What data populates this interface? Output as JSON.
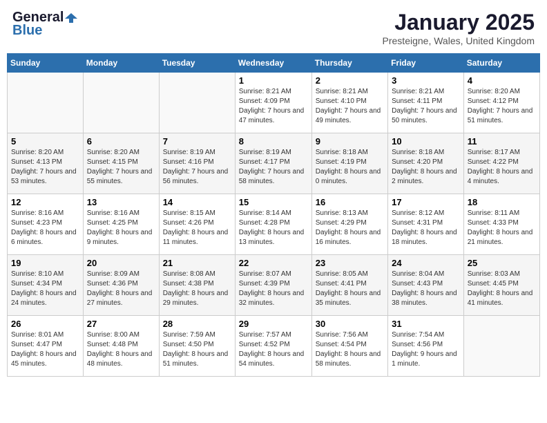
{
  "logo": {
    "general": "General",
    "blue": "Blue"
  },
  "header": {
    "title": "January 2025",
    "subtitle": "Presteigne, Wales, United Kingdom"
  },
  "weekdays": [
    "Sunday",
    "Monday",
    "Tuesday",
    "Wednesday",
    "Thursday",
    "Friday",
    "Saturday"
  ],
  "weeks": [
    [
      {
        "day": "",
        "info": ""
      },
      {
        "day": "",
        "info": ""
      },
      {
        "day": "",
        "info": ""
      },
      {
        "day": "1",
        "info": "Sunrise: 8:21 AM\nSunset: 4:09 PM\nDaylight: 7 hours and 47 minutes."
      },
      {
        "day": "2",
        "info": "Sunrise: 8:21 AM\nSunset: 4:10 PM\nDaylight: 7 hours and 49 minutes."
      },
      {
        "day": "3",
        "info": "Sunrise: 8:21 AM\nSunset: 4:11 PM\nDaylight: 7 hours and 50 minutes."
      },
      {
        "day": "4",
        "info": "Sunrise: 8:20 AM\nSunset: 4:12 PM\nDaylight: 7 hours and 51 minutes."
      }
    ],
    [
      {
        "day": "5",
        "info": "Sunrise: 8:20 AM\nSunset: 4:13 PM\nDaylight: 7 hours and 53 minutes."
      },
      {
        "day": "6",
        "info": "Sunrise: 8:20 AM\nSunset: 4:15 PM\nDaylight: 7 hours and 55 minutes."
      },
      {
        "day": "7",
        "info": "Sunrise: 8:19 AM\nSunset: 4:16 PM\nDaylight: 7 hours and 56 minutes."
      },
      {
        "day": "8",
        "info": "Sunrise: 8:19 AM\nSunset: 4:17 PM\nDaylight: 7 hours and 58 minutes."
      },
      {
        "day": "9",
        "info": "Sunrise: 8:18 AM\nSunset: 4:19 PM\nDaylight: 8 hours and 0 minutes."
      },
      {
        "day": "10",
        "info": "Sunrise: 8:18 AM\nSunset: 4:20 PM\nDaylight: 8 hours and 2 minutes."
      },
      {
        "day": "11",
        "info": "Sunrise: 8:17 AM\nSunset: 4:22 PM\nDaylight: 8 hours and 4 minutes."
      }
    ],
    [
      {
        "day": "12",
        "info": "Sunrise: 8:16 AM\nSunset: 4:23 PM\nDaylight: 8 hours and 6 minutes."
      },
      {
        "day": "13",
        "info": "Sunrise: 8:16 AM\nSunset: 4:25 PM\nDaylight: 8 hours and 9 minutes."
      },
      {
        "day": "14",
        "info": "Sunrise: 8:15 AM\nSunset: 4:26 PM\nDaylight: 8 hours and 11 minutes."
      },
      {
        "day": "15",
        "info": "Sunrise: 8:14 AM\nSunset: 4:28 PM\nDaylight: 8 hours and 13 minutes."
      },
      {
        "day": "16",
        "info": "Sunrise: 8:13 AM\nSunset: 4:29 PM\nDaylight: 8 hours and 16 minutes."
      },
      {
        "day": "17",
        "info": "Sunrise: 8:12 AM\nSunset: 4:31 PM\nDaylight: 8 hours and 18 minutes."
      },
      {
        "day": "18",
        "info": "Sunrise: 8:11 AM\nSunset: 4:33 PM\nDaylight: 8 hours and 21 minutes."
      }
    ],
    [
      {
        "day": "19",
        "info": "Sunrise: 8:10 AM\nSunset: 4:34 PM\nDaylight: 8 hours and 24 minutes."
      },
      {
        "day": "20",
        "info": "Sunrise: 8:09 AM\nSunset: 4:36 PM\nDaylight: 8 hours and 27 minutes."
      },
      {
        "day": "21",
        "info": "Sunrise: 8:08 AM\nSunset: 4:38 PM\nDaylight: 8 hours and 29 minutes."
      },
      {
        "day": "22",
        "info": "Sunrise: 8:07 AM\nSunset: 4:39 PM\nDaylight: 8 hours and 32 minutes."
      },
      {
        "day": "23",
        "info": "Sunrise: 8:05 AM\nSunset: 4:41 PM\nDaylight: 8 hours and 35 minutes."
      },
      {
        "day": "24",
        "info": "Sunrise: 8:04 AM\nSunset: 4:43 PM\nDaylight: 8 hours and 38 minutes."
      },
      {
        "day": "25",
        "info": "Sunrise: 8:03 AM\nSunset: 4:45 PM\nDaylight: 8 hours and 41 minutes."
      }
    ],
    [
      {
        "day": "26",
        "info": "Sunrise: 8:01 AM\nSunset: 4:47 PM\nDaylight: 8 hours and 45 minutes."
      },
      {
        "day": "27",
        "info": "Sunrise: 8:00 AM\nSunset: 4:48 PM\nDaylight: 8 hours and 48 minutes."
      },
      {
        "day": "28",
        "info": "Sunrise: 7:59 AM\nSunset: 4:50 PM\nDaylight: 8 hours and 51 minutes."
      },
      {
        "day": "29",
        "info": "Sunrise: 7:57 AM\nSunset: 4:52 PM\nDaylight: 8 hours and 54 minutes."
      },
      {
        "day": "30",
        "info": "Sunrise: 7:56 AM\nSunset: 4:54 PM\nDaylight: 8 hours and 58 minutes."
      },
      {
        "day": "31",
        "info": "Sunrise: 7:54 AM\nSunset: 4:56 PM\nDaylight: 9 hours and 1 minute."
      },
      {
        "day": "",
        "info": ""
      }
    ]
  ]
}
